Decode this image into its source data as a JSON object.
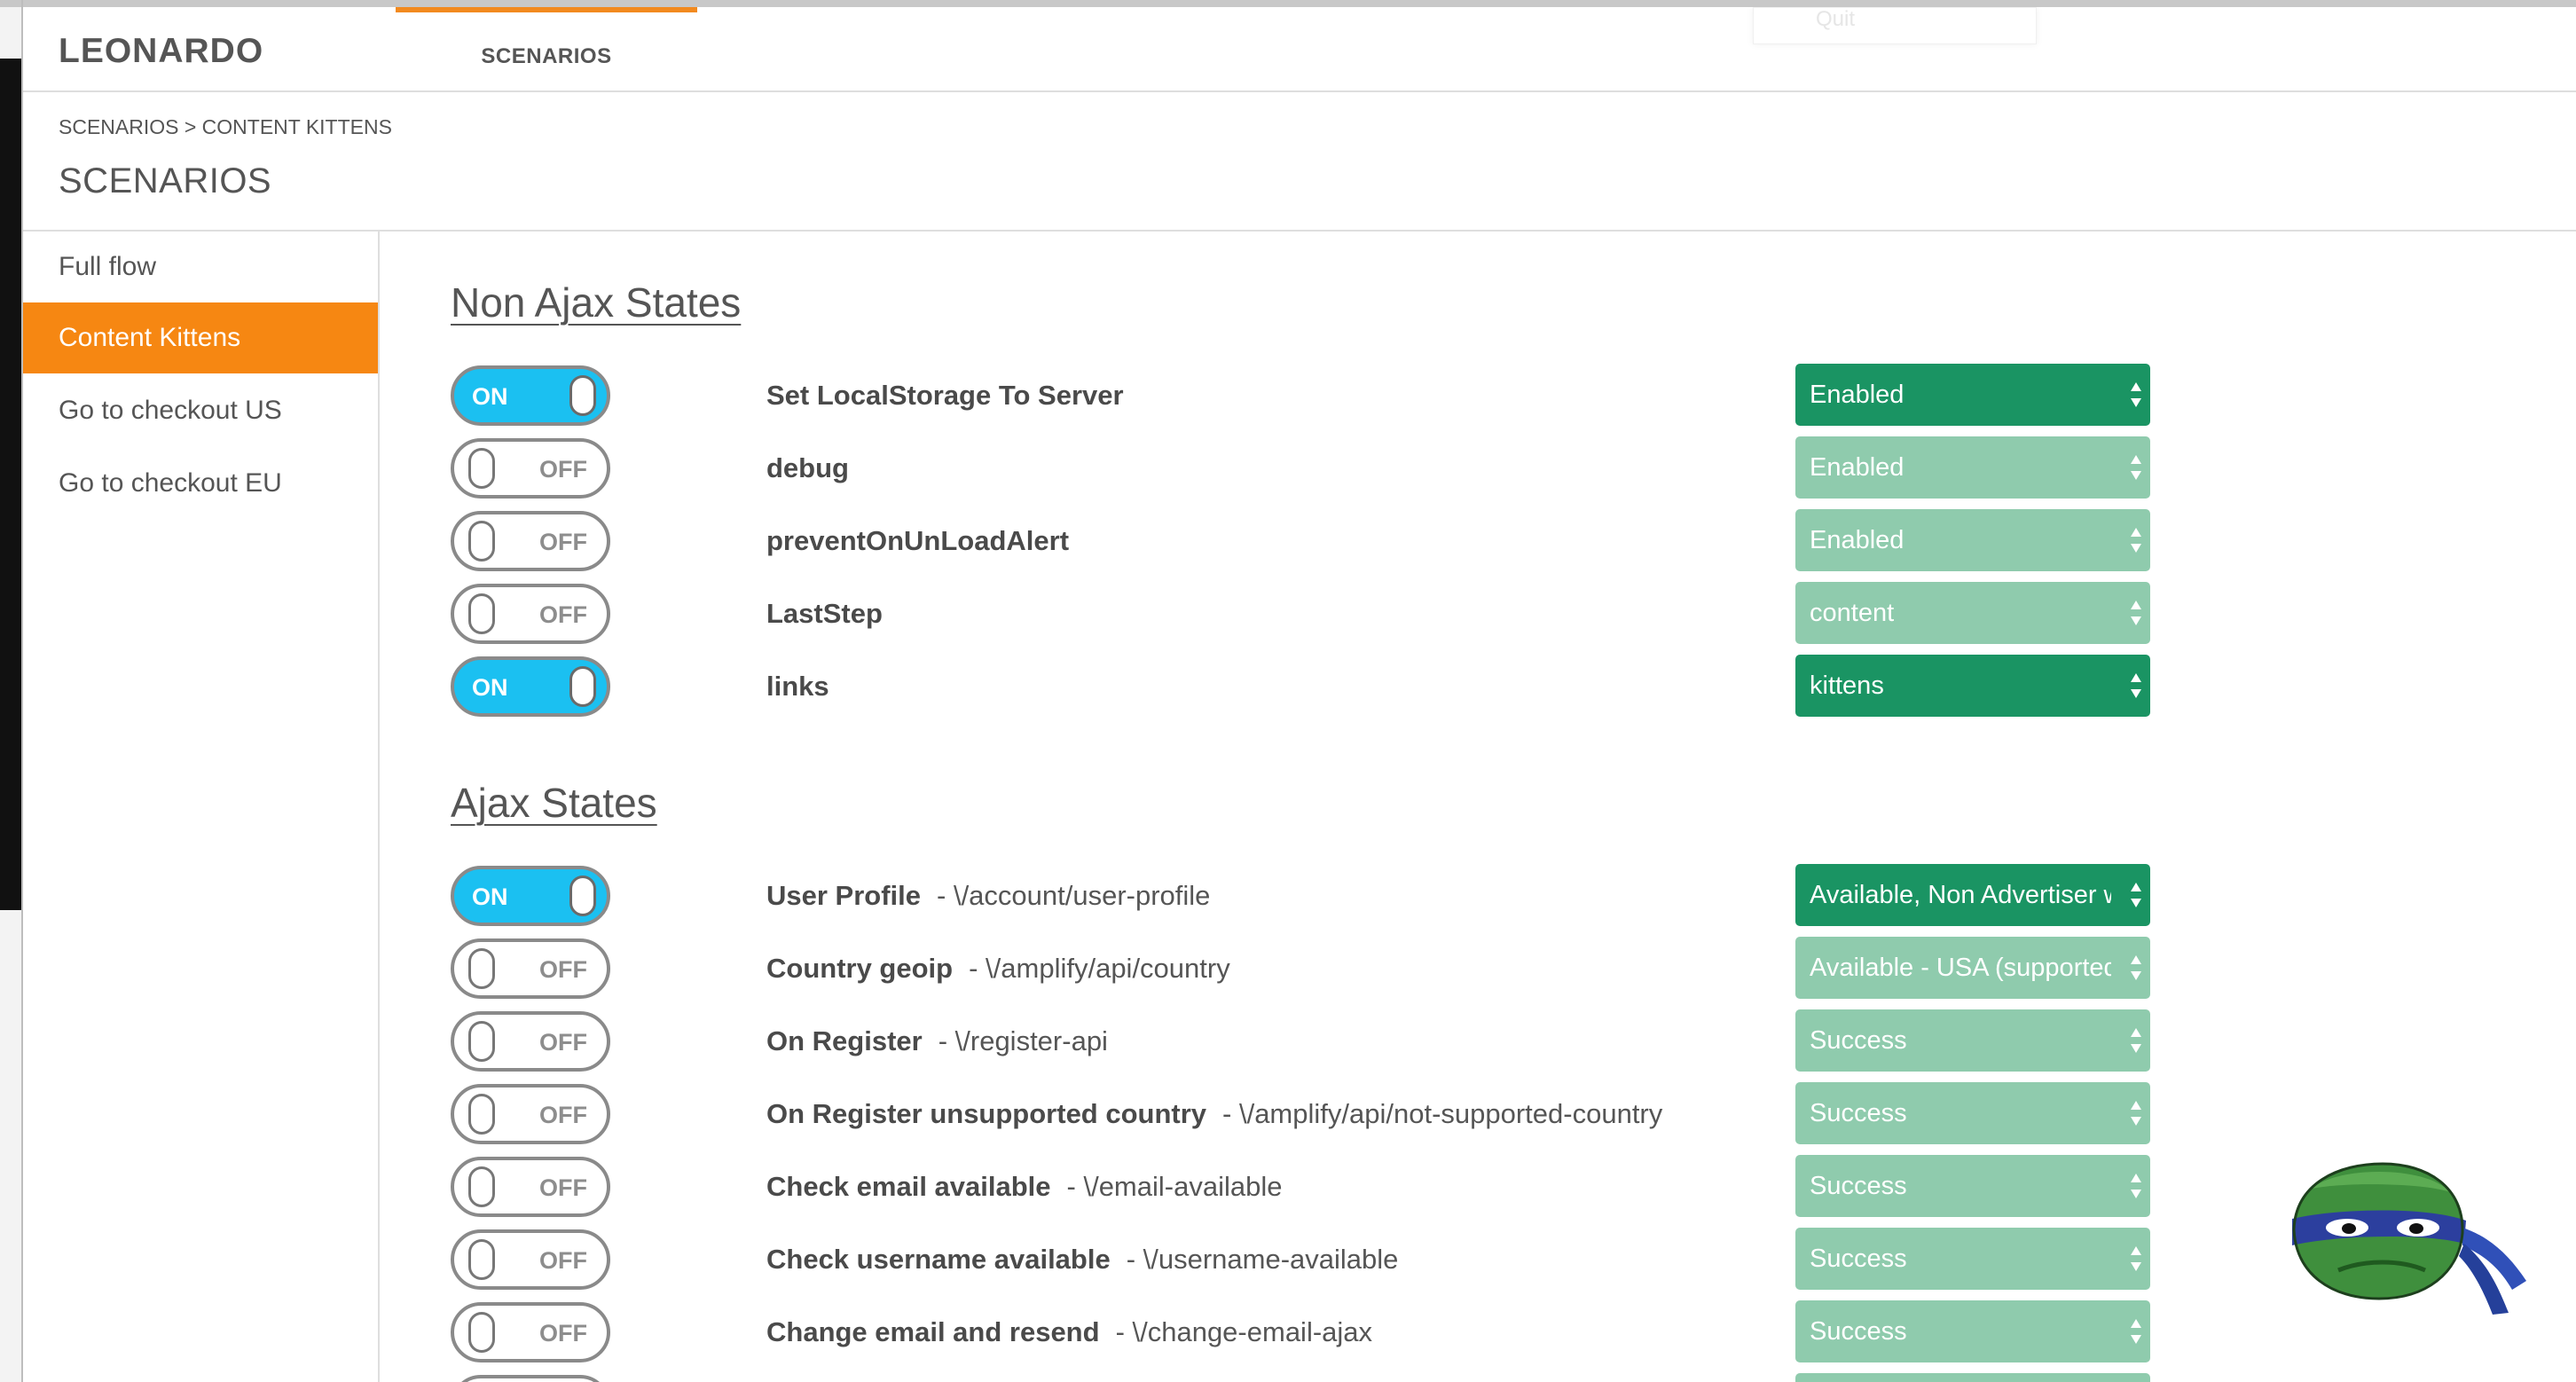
{
  "header": {
    "logo": "LEONARDO",
    "tab": "SCENARIOS",
    "faint_button": "Quit"
  },
  "breadcrumb": "SCENARIOS > CONTENT KITTENS",
  "page_title": "SCENARIOS",
  "sidebar": {
    "items": [
      {
        "label": "Full flow",
        "active": false
      },
      {
        "label": "Content Kittens",
        "active": true
      },
      {
        "label": "Go to checkout US",
        "active": false
      },
      {
        "label": "Go to checkout EU",
        "active": false
      }
    ]
  },
  "non_ajax": {
    "title": "Non Ajax States",
    "rows": [
      {
        "toggle": "ON",
        "label": "Set LocalStorage To Server",
        "path": "",
        "value": "Enabled"
      },
      {
        "toggle": "OFF",
        "label": "debug",
        "path": "",
        "value": "Enabled"
      },
      {
        "toggle": "OFF",
        "label": "preventOnUnLoadAlert",
        "path": "",
        "value": "Enabled"
      },
      {
        "toggle": "OFF",
        "label": "LastStep",
        "path": "",
        "value": "content"
      },
      {
        "toggle": "ON",
        "label": "links",
        "path": "",
        "value": "kittens"
      }
    ]
  },
  "ajax": {
    "title": "Ajax States",
    "rows": [
      {
        "toggle": "ON",
        "label": "User Profile",
        "path": "- \\/account/user-profile",
        "value": "Available, Non Advertiser w"
      },
      {
        "toggle": "OFF",
        "label": "Country geoip",
        "path": "- \\/amplify/api/country",
        "value": "Available - USA (supported"
      },
      {
        "toggle": "OFF",
        "label": "On Register",
        "path": "- \\/register-api",
        "value": "Success"
      },
      {
        "toggle": "OFF",
        "label": "On Register unsupported country",
        "path": "- \\/amplify/api/not-supported-country",
        "value": "Success"
      },
      {
        "toggle": "OFF",
        "label": "Check email available",
        "path": "- \\/email-available",
        "value": "Success"
      },
      {
        "toggle": "OFF",
        "label": "Check username available",
        "path": "- \\/username-available",
        "value": "Success"
      },
      {
        "toggle": "OFF",
        "label": "Change email and resend",
        "path": "- \\/change-email-ajax",
        "value": "Success"
      }
    ]
  },
  "colors": {
    "accent_orange": "#f68712",
    "toggle_on": "#1bc0f1",
    "select_active": "#1a9463",
    "select_inactive": "#8fcbad"
  },
  "icons": {
    "mascot": "ninja-turtle-icon"
  }
}
